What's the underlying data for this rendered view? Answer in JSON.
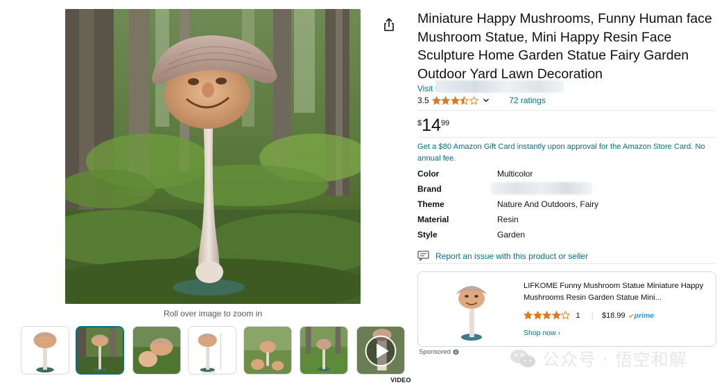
{
  "product": {
    "title": "Miniature Happy Mushrooms, Funny Human face Mushroom Statue, Mini Happy Resin Face Sculpture Home Garden Statue Fairy Garden Outdoor Yard Lawn Decoration",
    "store_link_prefix": "Visit t",
    "rating_value": "3.5",
    "rating_stars": 3.5,
    "ratings_count": "72 ratings",
    "price_symbol": "$",
    "price_whole": "14",
    "price_fraction": "99",
    "gift_offer": "Get a $80 Amazon Gift Card instantly upon approval for the Amazon Store Card. No annual fee."
  },
  "gallery": {
    "zoom_hint": "Roll over image to zoom in",
    "video_label": "VIDEO",
    "selected_index": 1
  },
  "specs": [
    {
      "key": "Color",
      "value": "Multicolor"
    },
    {
      "key": "Brand",
      "value": ""
    },
    {
      "key": "Theme",
      "value": "Nature And Outdoors, Fairy"
    },
    {
      "key": "Material",
      "value": "Resin"
    },
    {
      "key": "Style",
      "value": "Garden"
    }
  ],
  "report_link": "Report an issue with this product or seller",
  "ad": {
    "title": "LIFKOME Funny Mushroom Statue Miniature Happy Mushrooms Resin Garden Statue Mini...",
    "rating_stars": 4,
    "rating_count": "1",
    "price": "$18.99",
    "prime_label": "prime",
    "shop_now": "Shop now ›",
    "sponsored_label": "Sponsored"
  },
  "watermark": {
    "text": "公众号 · 悟空和解"
  },
  "colors": {
    "link": "#007185",
    "star": "#de7921",
    "prime": "#1a98ff",
    "text": "#0f1111"
  }
}
